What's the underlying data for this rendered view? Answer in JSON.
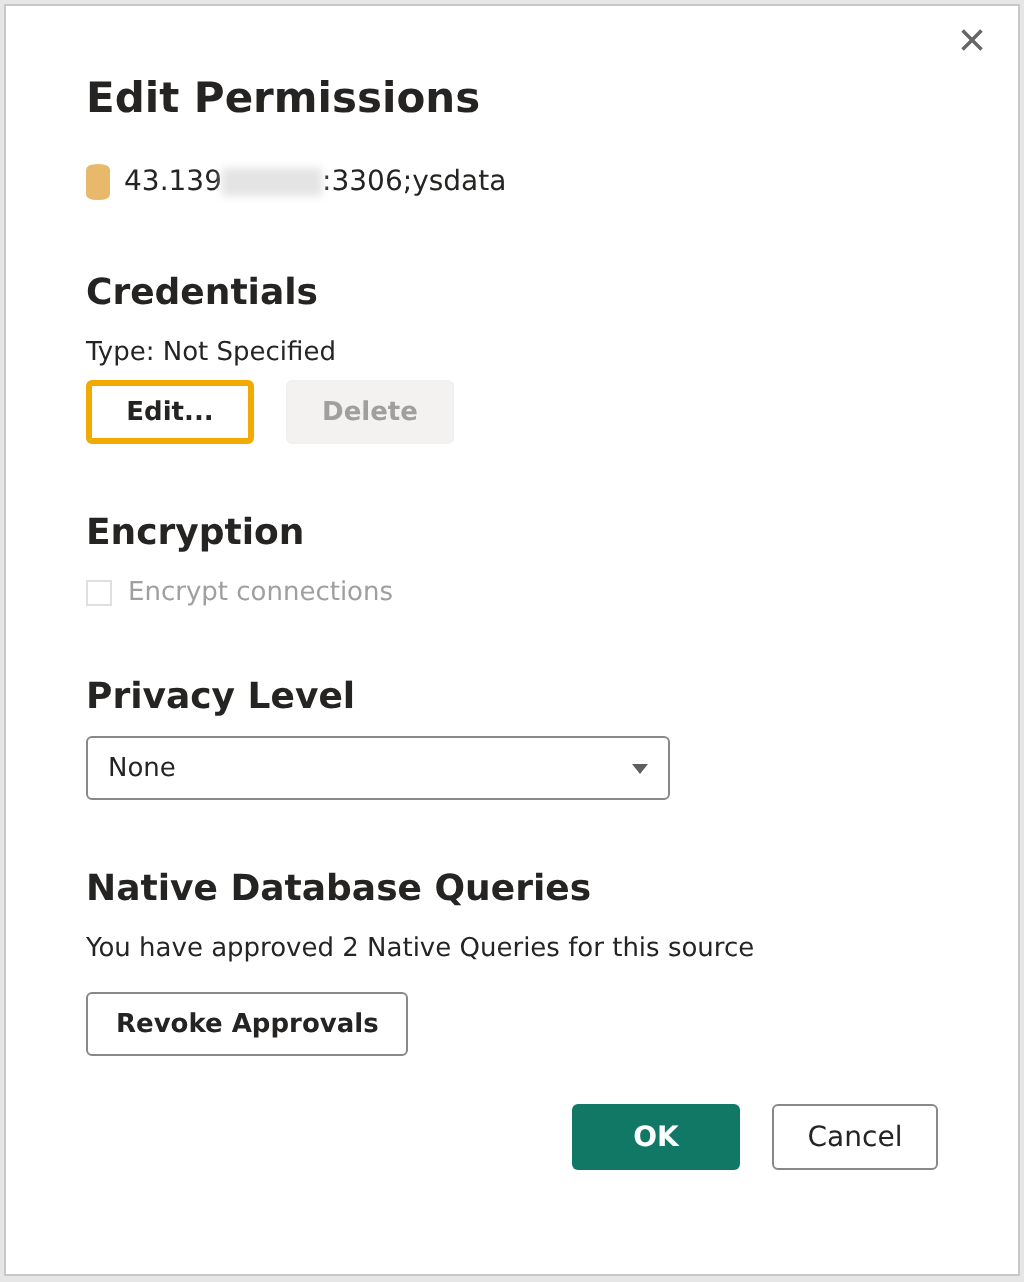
{
  "dialog": {
    "title": "Edit Permissions",
    "close": "×"
  },
  "source": {
    "address_start": "43.139",
    "address_end": ":3306;ysdata"
  },
  "credentials": {
    "heading": "Credentials",
    "type_text": "Type: Not Specified",
    "buttons": [
      {
        "label": "Edit...",
        "focused": true,
        "disabled": false
      },
      {
        "label": "Delete",
        "focused": false,
        "disabled": true
      }
    ]
  },
  "encryption": {
    "heading": "Encryption",
    "checkbox": {
      "label": "Encrypt connections",
      "checked": false,
      "disabled": true
    }
  },
  "privacy": {
    "heading": "Privacy Level",
    "select": {
      "value": "None"
    }
  },
  "native_queries": {
    "heading": "Native Database Queries",
    "text": "You have approved 2 Native Queries for this source",
    "button": "Revoke Approvals"
  },
  "footer": [
    {
      "label": "OK",
      "kind": "primary"
    },
    {
      "label": "Cancel",
      "kind": "secondary"
    }
  ]
}
